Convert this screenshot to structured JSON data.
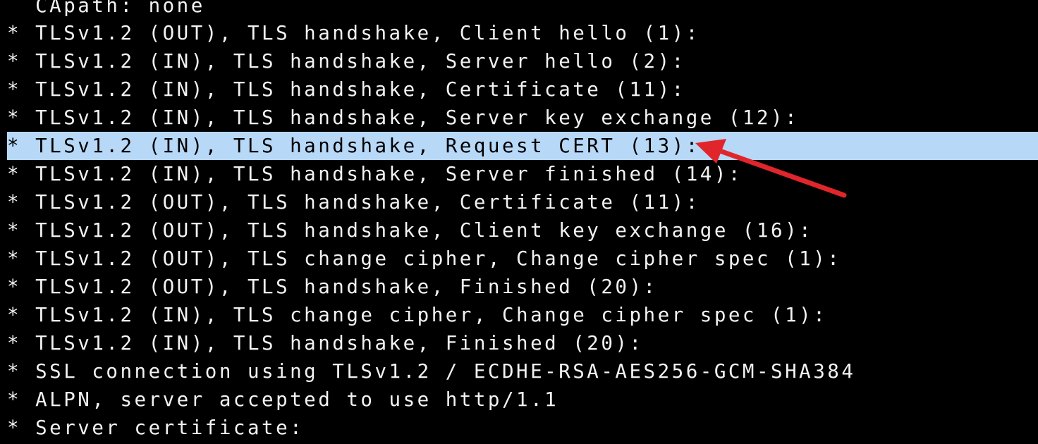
{
  "terminal": {
    "lines": [
      "  CApath: none",
      "* TLSv1.2 (OUT), TLS handshake, Client hello (1):",
      "* TLSv1.2 (IN), TLS handshake, Server hello (2):",
      "* TLSv1.2 (IN), TLS handshake, Certificate (11):",
      "* TLSv1.2 (IN), TLS handshake, Server key exchange (12):",
      "* TLSv1.2 (IN), TLS handshake, Request CERT (13):",
      "* TLSv1.2 (IN), TLS handshake, Server finished (14):",
      "* TLSv1.2 (OUT), TLS handshake, Certificate (11):",
      "* TLSv1.2 (OUT), TLS handshake, Client key exchange (16):",
      "* TLSv1.2 (OUT), TLS change cipher, Change cipher spec (1):",
      "* TLSv1.2 (OUT), TLS handshake, Finished (20):",
      "* TLSv1.2 (IN), TLS change cipher, Change cipher spec (1):",
      "* TLSv1.2 (IN), TLS handshake, Finished (20):",
      "* SSL connection using TLSv1.2 / ECDHE-RSA-AES256-GCM-SHA384",
      "* ALPN, server accepted to use http/1.1",
      "* Server certificate:"
    ]
  },
  "colors": {
    "background": "#000000",
    "text": "#f2f2f2",
    "highlight": "#b8d8f8",
    "arrow": "#e0262b"
  },
  "annotation": {
    "arrow_icon": "red-arrow-icon"
  }
}
